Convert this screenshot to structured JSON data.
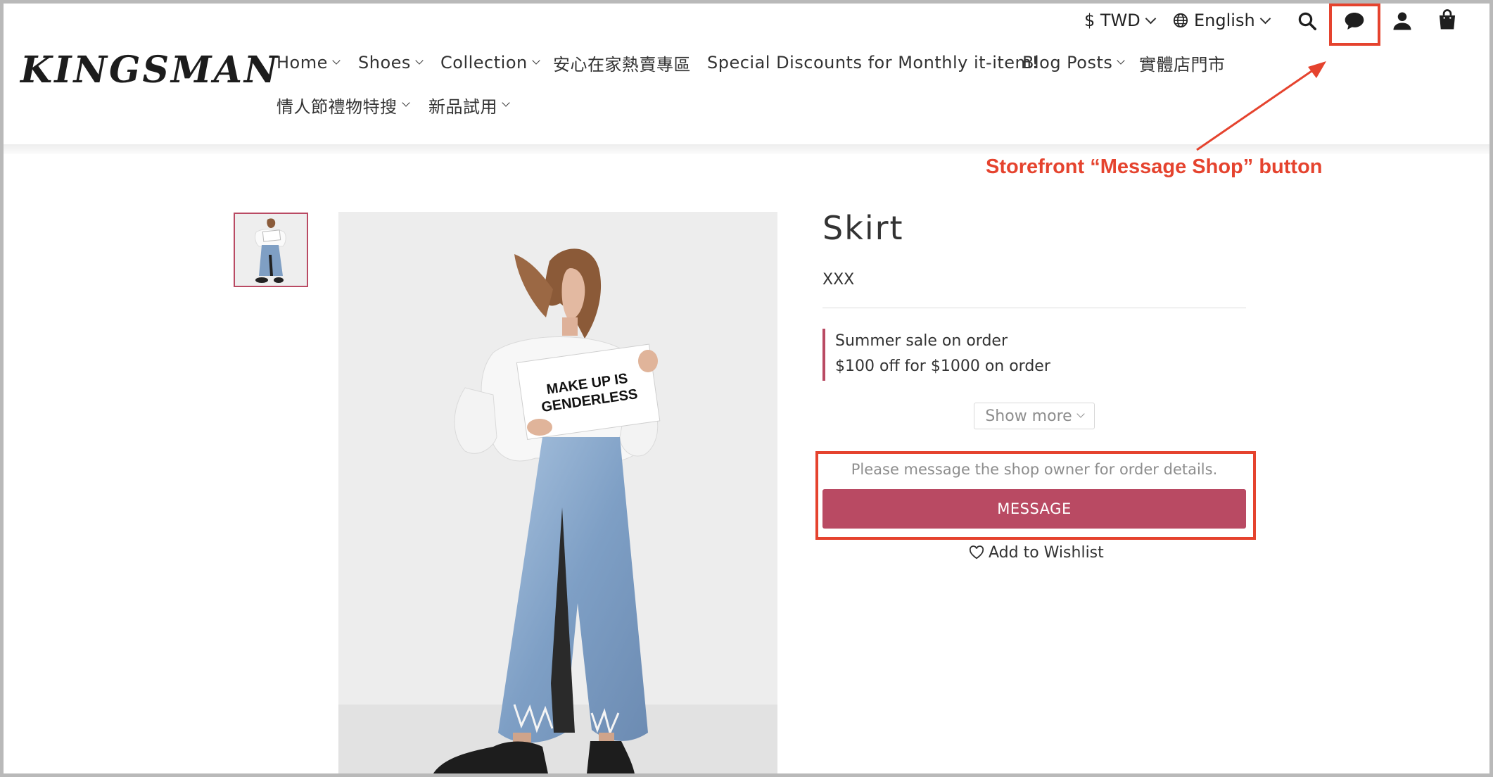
{
  "header": {
    "logo": "KINGSMAN",
    "currency": "$ TWD",
    "language": "English",
    "nav": [
      {
        "label": "Home",
        "has_dropdown": true
      },
      {
        "label": "Shoes",
        "has_dropdown": true
      },
      {
        "label": "Collection",
        "has_dropdown": true
      },
      {
        "label": "安心在家熱賣專區",
        "has_dropdown": false
      },
      {
        "label": "Special Discounts for Monthly it-item!",
        "has_dropdown": false
      },
      {
        "label": "Blog Posts",
        "has_dropdown": true
      },
      {
        "label": "實體店門市",
        "has_dropdown": false
      },
      {
        "label": "情人節禮物特搜",
        "has_dropdown": true
      },
      {
        "label": "新品試用",
        "has_dropdown": true
      }
    ],
    "icons": [
      "search-icon",
      "message-icon",
      "account-icon",
      "cart-icon"
    ]
  },
  "annotation": {
    "label": "Storefront “Message Shop” button",
    "color": "#e5432e"
  },
  "product": {
    "title": "Skirt",
    "sku": "XXX",
    "image_sign_text": [
      "MAKE UP IS",
      "GENDERLESS"
    ],
    "promotions": [
      "Summer sale on order",
      "$100 off for $1000 on order"
    ],
    "show_more": "Show more",
    "message_note": "Please message the shop owner for order details.",
    "message_button": "MESSAGE",
    "wishlist": "Add to Wishlist"
  },
  "colors": {
    "brand": "#b94a63",
    "highlight": "#e5432e",
    "muted_text": "#8d8d8d"
  }
}
